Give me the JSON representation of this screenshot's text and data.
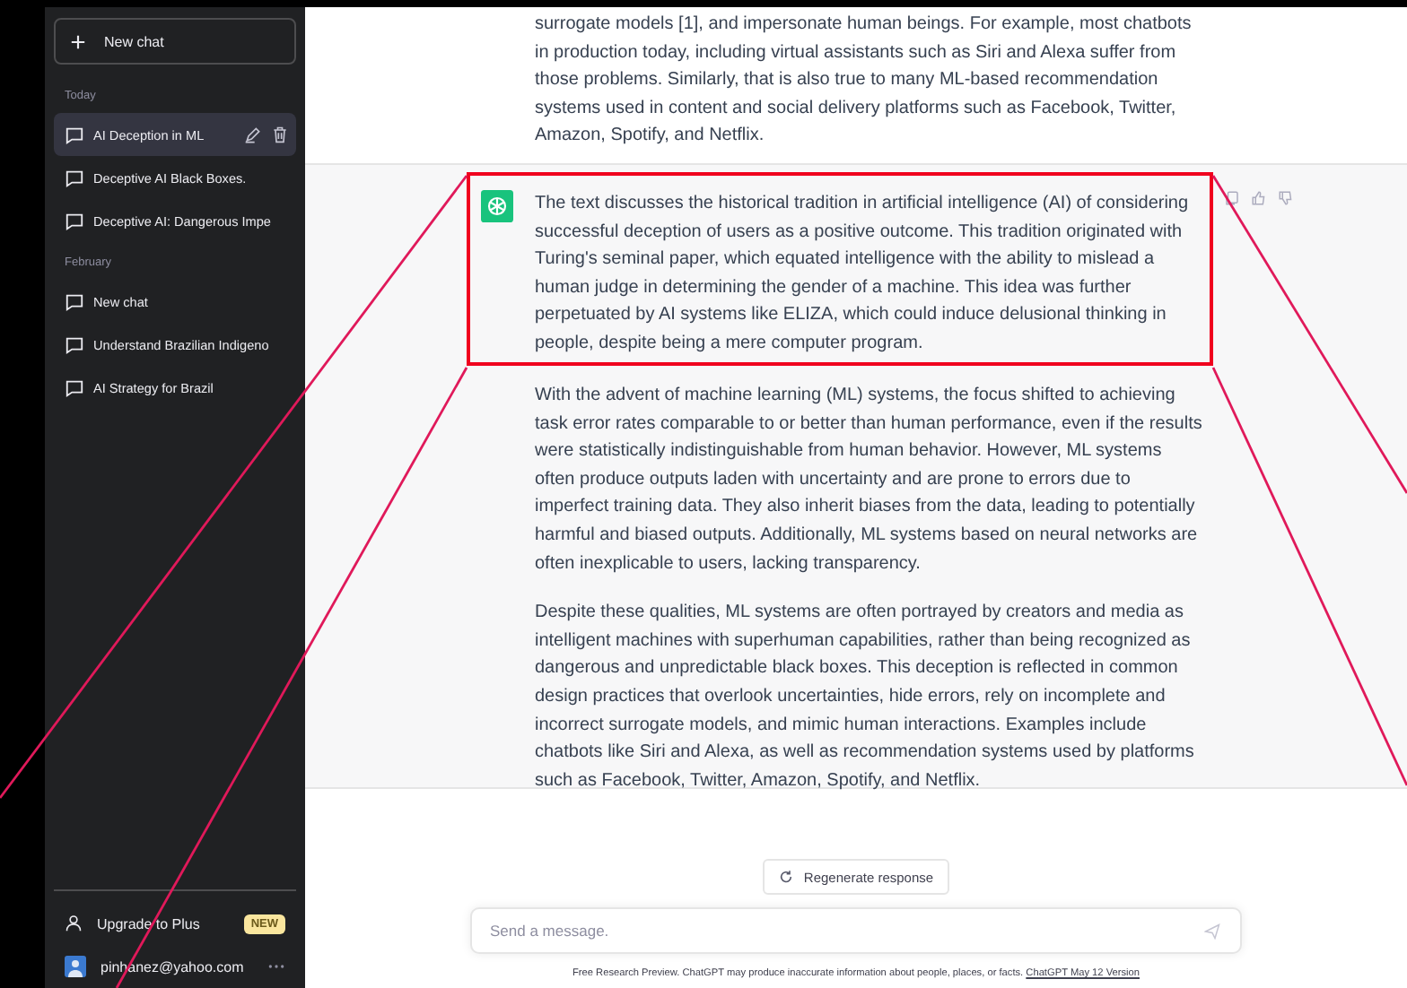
{
  "sidebar": {
    "new_chat": "New chat",
    "groups": [
      {
        "label": "Today",
        "items": [
          {
            "title": "AI Deception in ML",
            "selected": true
          },
          {
            "title": "Deceptive AI Black Boxes.",
            "selected": false
          },
          {
            "title": "Deceptive AI: Dangerous Impe",
            "selected": false
          }
        ]
      },
      {
        "label": "February",
        "items": [
          {
            "title": "New chat",
            "selected": false
          },
          {
            "title": "Understand Brazilian Indigeno",
            "selected": false
          },
          {
            "title": "AI Strategy for Brazil",
            "selected": false
          }
        ]
      }
    ],
    "upgrade": {
      "label": "Upgrade to Plus",
      "badge": "NEW"
    },
    "user": {
      "email": "pinhanez@yahoo.com"
    }
  },
  "messages": [
    {
      "kind": "user",
      "paragraphs": [
        "surrogate models [1], and impersonate human beings. For example, most chatbots in production today, including virtual assistants such as Siri and Alexa suffer from those problems. Similarly, that is also true to many ML-based recommendation systems used in content and social delivery platforms such as Facebook, Twitter, Amazon, Spotify, and Netflix."
      ]
    },
    {
      "kind": "assistant",
      "paragraphs": [
        "The text discusses the historical tradition in artificial intelligence (AI) of considering successful deception of users as a positive outcome. This tradition originated with Turing's seminal paper, which equated intelligence with the ability to mislead a human judge in determining the gender of a machine. This idea was further perpetuated by AI systems like ELIZA, which could induce delusional thinking in people, despite being a mere computer program.",
        "With the advent of machine learning (ML) systems, the focus shifted to achieving task error rates comparable to or better than human performance, even if the results were statistically indistinguishable from human behavior. However, ML systems often produce outputs laden with uncertainty and are prone to errors due to imperfect training data. They also inherit biases from the data, leading to potentially harmful and biased outputs. Additionally, ML systems based on neural networks are often inexplicable to users, lacking transparency.",
        "Despite these qualities, ML systems are often portrayed by creators and media as intelligent machines with superhuman capabilities, rather than being recognized as dangerous and unpredictable black boxes. This deception is reflected in common design practices that overlook uncertainties, hide errors, rely on incomplete and incorrect surrogate models, and mimic human interactions. Examples include chatbots like Siri and Alexa, as well as recommendation systems used by platforms such as Facebook, Twitter, Amazon, Spotify, and Netflix."
      ]
    }
  ],
  "regenerate_button": "Regenerate response",
  "composer": {
    "placeholder": "Send a message."
  },
  "footer": {
    "text": "Free Research Preview. ChatGPT may produce inaccurate information about people, places, or facts.",
    "link": "ChatGPT May 12 Version"
  }
}
